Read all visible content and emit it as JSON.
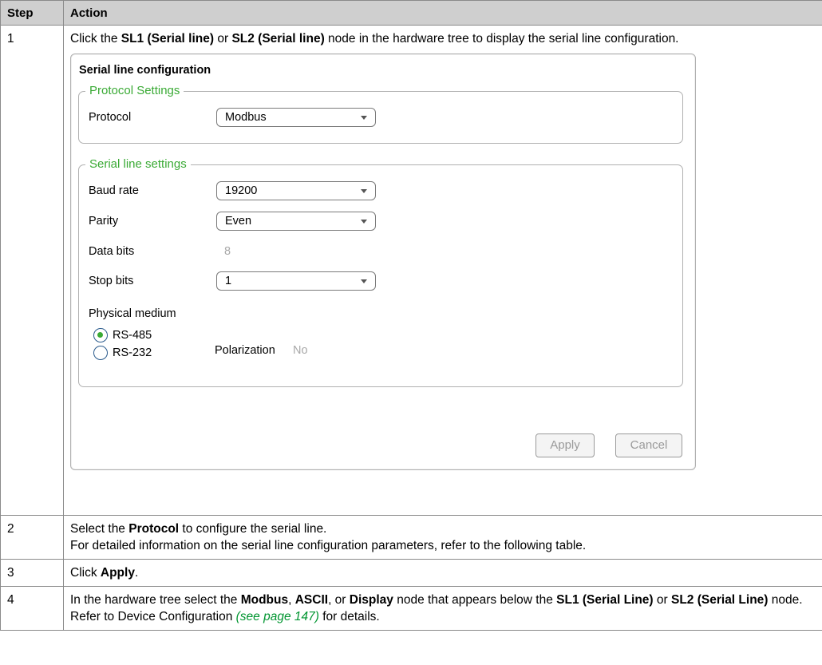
{
  "table": {
    "headers": {
      "step": "Step",
      "action": "Action"
    }
  },
  "rows": [
    {
      "step": "1",
      "parts": [
        "Click the ",
        "SL1 (Serial line)",
        " or ",
        "SL2 (Serial line)",
        " node in the hardware tree to display the serial line configuration."
      ]
    },
    {
      "step": "2",
      "line1": [
        "Select the ",
        "Protocol",
        " to configure the serial line."
      ],
      "line2": "For detailed information on the serial line configuration parameters, refer to the following table."
    },
    {
      "step": "3",
      "parts": [
        "Click ",
        "Apply",
        "."
      ]
    },
    {
      "step": "4",
      "parts": [
        "In the hardware tree select the ",
        "Modbus",
        ", ",
        "ASCII",
        ", or ",
        "Display",
        " node that appears below the ",
        "SL1 (Serial Line)",
        " or ",
        "SL2 (Serial Line)",
        " node. Refer to Device Configuration ",
        "(see page 147)",
        " for details."
      ]
    }
  ],
  "config": {
    "title": "Serial line configuration",
    "protocol_group": "Protocol Settings",
    "protocol_label": "Protocol",
    "protocol_value": "Modbus",
    "serial_group": "Serial line settings",
    "baud_label": "Baud rate",
    "baud_value": "19200",
    "parity_label": "Parity",
    "parity_value": "Even",
    "databits_label": "Data bits",
    "databits_value": "8",
    "stopbits_label": "Stop bits",
    "stopbits_value": "1",
    "medium_label": "Physical medium",
    "rs485": "RS-485",
    "rs232": "RS-232",
    "selected_medium": "RS-485",
    "polarization_label": "Polarization",
    "polarization_value": "No",
    "apply": "Apply",
    "cancel": "Cancel"
  },
  "colors": {
    "accent": "#3aaa35",
    "header_bg": "#cfcfcf",
    "disabled_text": "#9a9a9a"
  }
}
